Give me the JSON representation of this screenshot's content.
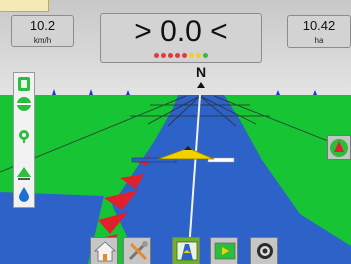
{
  "speed": {
    "value": "10.2",
    "unit": "km/h"
  },
  "guidance": {
    "cross_track": "> 0.0 <",
    "heading": "N",
    "light_bar": [
      "#e8383c",
      "#e8383c",
      "#e8383c",
      "#e8383c",
      "#e8383c",
      "#f0d020",
      "#f0d020",
      "#3cb54a"
    ]
  },
  "area": {
    "value": "10.42",
    "unit": "ha"
  },
  "sidebar": {
    "tools": [
      {
        "icon": "steering-status-icon"
      },
      {
        "icon": "nudge-icon"
      },
      {
        "icon": "gps-status-icon"
      },
      {
        "icon": "boom-status-icon"
      },
      {
        "icon": "droplet-icon"
      }
    ]
  },
  "right_button": {
    "icon": "north-up-compass-icon"
  },
  "bottom_nav": [
    {
      "icon": "home-icon",
      "active": false
    },
    {
      "icon": "tools-icon",
      "active": false
    },
    {
      "icon": "guidance-view-icon",
      "active": true
    },
    {
      "icon": "field-map-icon",
      "active": false
    },
    {
      "icon": "settings-gear-icon",
      "active": false
    }
  ],
  "colors": {
    "sky": "#d0d0d0",
    "grass": "#17c534",
    "covered": "#2d63c8",
    "guideline": "#f2f2f2",
    "active_nav": "#6fae2e"
  }
}
